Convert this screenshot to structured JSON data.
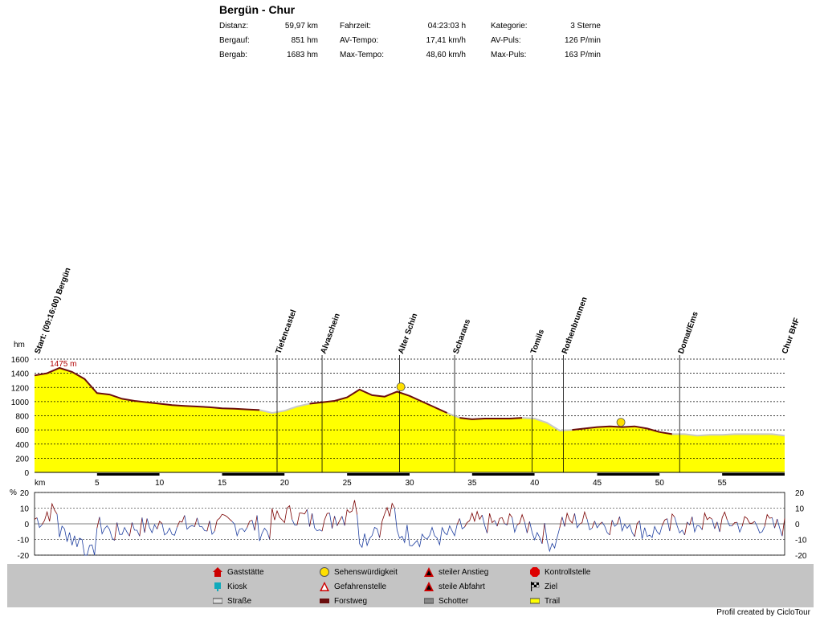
{
  "header": {
    "title": "Bergün - Chur",
    "stats": [
      {
        "label": "Distanz:",
        "value": "59,97 km"
      },
      {
        "label": "Bergauf:",
        "value": "851 hm"
      },
      {
        "label": "Bergab:",
        "value": "1683 hm"
      },
      {
        "label": "Fahrzeit:",
        "value": "04:23:03 h"
      },
      {
        "label": "AV-Tempo:",
        "value": "17,41 km/h"
      },
      {
        "label": "Max-Tempo:",
        "value": "48,60 km/h"
      },
      {
        "label": "Kategorie:",
        "value": "3 Sterne"
      },
      {
        "label": "AV-Puls:",
        "value": "126 P/min"
      },
      {
        "label": "Max-Puls:",
        "value": "163 P/min"
      }
    ]
  },
  "chart_data": [
    {
      "type": "area",
      "ylabel": "hm",
      "xlabel": "km",
      "xlim": [
        0,
        60
      ],
      "ylim": [
        0,
        1600
      ],
      "yticks": [
        0,
        200,
        400,
        600,
        800,
        1000,
        1200,
        1400,
        1600
      ],
      "xticks": [
        5,
        10,
        15,
        20,
        25,
        30,
        35,
        40,
        45,
        50,
        55
      ],
      "peak_label": "1475 m",
      "grid": true,
      "x": [
        0,
        1,
        2,
        3,
        4,
        5,
        6,
        7,
        8,
        9,
        10,
        11,
        12,
        13,
        14,
        15,
        16,
        17,
        18,
        19,
        20,
        21,
        22,
        23,
        24,
        25,
        26,
        27,
        28,
        29,
        30,
        31,
        32,
        33,
        34,
        35,
        36,
        37,
        38,
        39,
        40,
        41,
        42,
        43,
        44,
        45,
        46,
        47,
        48,
        49,
        50,
        51,
        52,
        53,
        54,
        55,
        56,
        57,
        58,
        59,
        60
      ],
      "elevation": [
        1370,
        1400,
        1475,
        1420,
        1320,
        1120,
        1100,
        1040,
        1010,
        990,
        970,
        950,
        940,
        930,
        920,
        905,
        900,
        890,
        880,
        840,
        870,
        930,
        970,
        990,
        1010,
        1060,
        1170,
        1090,
        1070,
        1140,
        1080,
        1000,
        920,
        840,
        770,
        750,
        760,
        760,
        760,
        770,
        760,
        700,
        590,
        600,
        620,
        640,
        650,
        640,
        650,
        620,
        570,
        540,
        540,
        520,
        530,
        530,
        540,
        540,
        540,
        540,
        520
      ],
      "waypoints": [
        {
          "km": 0,
          "name": "Start: (09:16:00) Bergün"
        },
        {
          "km": 19.4,
          "name": "Tiefencastel"
        },
        {
          "km": 23.0,
          "name": "Alvaschein"
        },
        {
          "km": 29.2,
          "name": "Alter Schin"
        },
        {
          "km": 33.6,
          "name": "Scharans"
        },
        {
          "km": 39.8,
          "name": "Tomils"
        },
        {
          "km": 42.3,
          "name": "Rothenbrunnen"
        },
        {
          "km": 51.6,
          "name": "Domat/Ems"
        },
        {
          "km": 59.9,
          "name": "Chur BHF"
        }
      ],
      "sights_km": [
        29.3,
        46.9
      ]
    },
    {
      "type": "line",
      "ylabel": "%",
      "ylim": [
        -20,
        20
      ],
      "yticks": [
        20,
        10,
        0,
        -10,
        -20
      ],
      "grid": true
    }
  ],
  "legend": [
    {
      "icon": "restaurant-icon",
      "label": "Gaststätte"
    },
    {
      "icon": "kiosk-icon",
      "label": "Kiosk"
    },
    {
      "icon": "road-icon",
      "label": "Straße",
      "color": "#dddddd"
    },
    {
      "icon": "sight-icon",
      "label": "Sehenswürdigkeit"
    },
    {
      "icon": "danger-icon",
      "label": "Gefahrenstelle"
    },
    {
      "icon": "forest-road-icon",
      "label": "Forstweg",
      "color": "#6b0d0d"
    },
    {
      "icon": "steep-up-icon",
      "label": "steiler Anstieg"
    },
    {
      "icon": "steep-down-icon",
      "label": "steile Abfahrt"
    },
    {
      "icon": "gravel-icon",
      "label": "Schotter",
      "color": "#888888"
    },
    {
      "icon": "stop-icon",
      "label": "Kontrollstelle"
    },
    {
      "icon": "finish-flag-icon",
      "label": "Ziel"
    },
    {
      "icon": "trail-icon",
      "label": "Trail",
      "color": "#ffff00"
    }
  ],
  "footer": {
    "credit": "Profil created by CicloTour"
  },
  "colors": {
    "fill": "#ffff00",
    "road": "#c8c8c8",
    "forest": "#6b0d0d",
    "up": "#7a0000",
    "down": "#1f3fa0"
  }
}
